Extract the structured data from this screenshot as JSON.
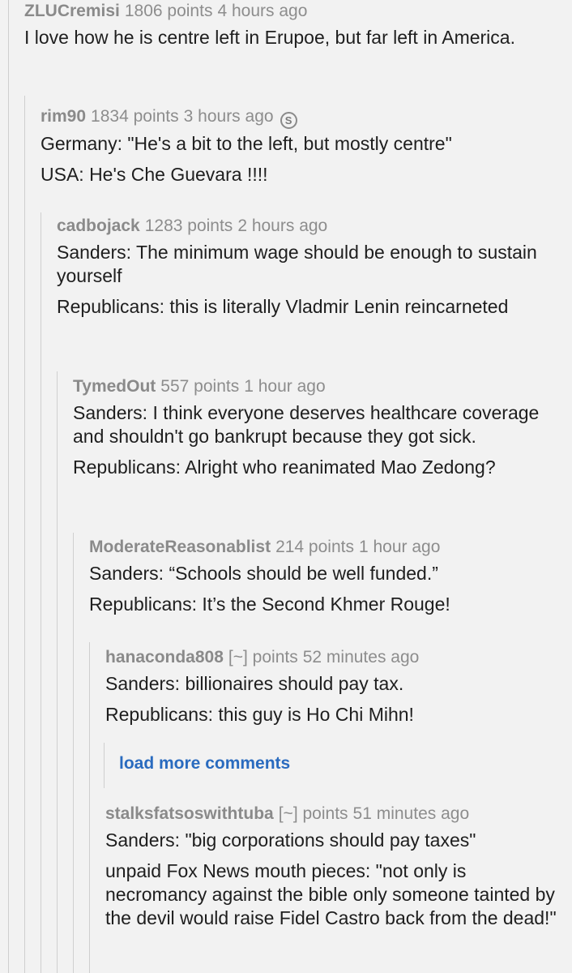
{
  "comments": [
    {
      "author": "ZLUCremisi",
      "points": "1806 points",
      "age": "4 hours ago",
      "paragraphs": [
        "I love how he is centre left in Erupoe, but far left in America."
      ]
    },
    {
      "author": "rim90",
      "points": "1834 points",
      "age": "3 hours ago",
      "badge_icon": "gilded-icon",
      "badge_glyph": "S",
      "paragraphs": [
        "Germany: \"He's a bit to the left, but mostly centre\"",
        "USA: He's Che Guevara !!!!"
      ]
    },
    {
      "author": "cadbojack",
      "points": "1283 points",
      "age": "2 hours ago",
      "paragraphs": [
        "Sanders: The minimum wage should be enough to sustain yourself",
        "Republicans: this is literally Vladmir Lenin reincarneted"
      ]
    },
    {
      "author": "TymedOut",
      "points": "557 points",
      "age": "1 hour ago",
      "paragraphs": [
        "Sanders: I think everyone deserves healthcare coverage and shouldn't go bankrupt because they got sick.",
        "Republicans: Alright who reanimated Mao Zedong?"
      ]
    },
    {
      "author": "ModerateReasonablist",
      "points": "214 points",
      "age": "1 hour ago",
      "paragraphs": [
        "Sanders: “Schools should be well funded.”",
        "Republicans: It’s the Second Khmer Rouge!"
      ]
    },
    {
      "author": "hanaconda808",
      "points": "[~] points",
      "age": "52 minutes ago",
      "paragraphs": [
        "Sanders: billionaires should pay tax.",
        "Republicans: this guy is Ho Chi Mihn!"
      ]
    },
    {
      "author": "stalksfatsoswithtuba",
      "points": "[~] points",
      "age": "51 minutes ago",
      "paragraphs": [
        "Sanders: \"big corporations should pay taxes\"",
        "unpaid Fox News mouth pieces: \"not only is necromancy against the bible only someone tainted by the devil would raise Fidel Castro back from the dead!\""
      ]
    }
  ],
  "load_more": {
    "label": "load more comments"
  },
  "colors": {
    "background": "#f2f2f2",
    "meta_text": "#8a8a8a",
    "body_text": "#1e1e1e",
    "link": "#2a6bbf",
    "thread_rail": "#cfcfcf"
  }
}
